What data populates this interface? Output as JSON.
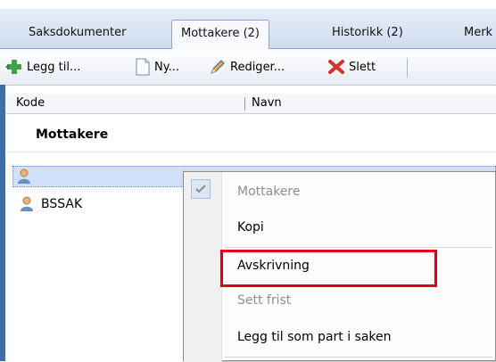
{
  "tabs": [
    {
      "label": "Saksdokumenter"
    },
    {
      "label": "Mottakere (2)"
    },
    {
      "label": "Historikk (2)"
    },
    {
      "label": "Merk"
    }
  ],
  "toolbar": {
    "add_label": "Legg til...",
    "new_label": "Ny...",
    "edit_label": "Rediger...",
    "delete_label": "Slett"
  },
  "columns": {
    "code": "Kode",
    "name": "Navn"
  },
  "group": {
    "title": "Mottakere"
  },
  "rows": [
    {
      "code": ""
    },
    {
      "code": "BSSAK"
    }
  ],
  "context_menu": {
    "items": [
      {
        "label": "Mottakere"
      },
      {
        "label": "Kopi"
      },
      {
        "label": "Avskrivning"
      },
      {
        "label": "Sett frist"
      },
      {
        "label": "Legg til som part i saken"
      }
    ]
  },
  "colors": {
    "highlight": "#e0001b",
    "selection": "#cfe0f8"
  }
}
